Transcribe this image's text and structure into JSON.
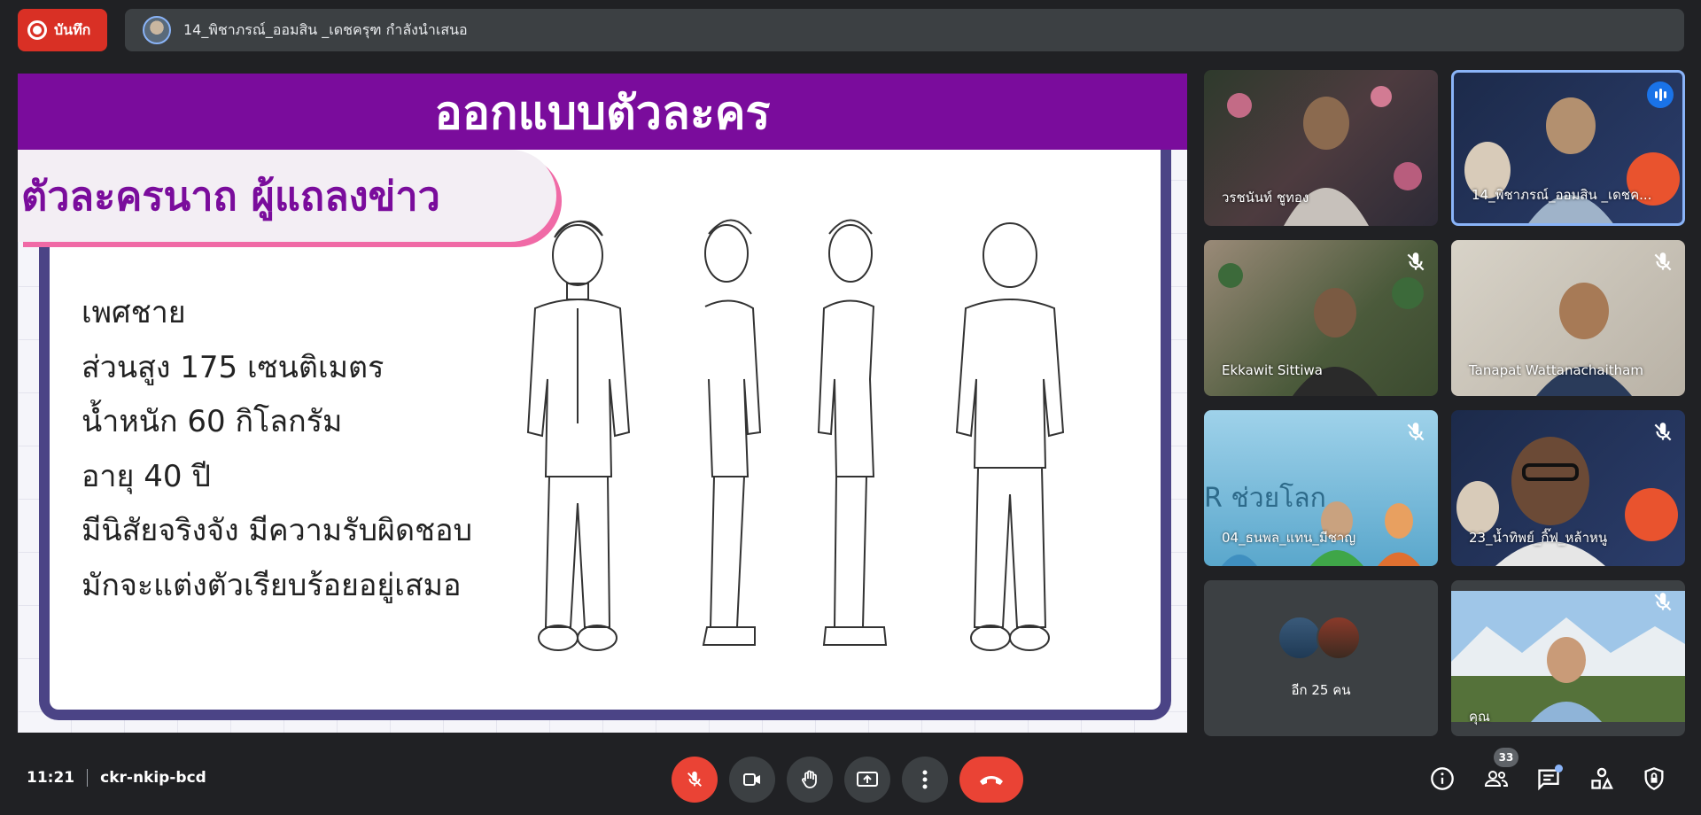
{
  "top_bar": {
    "record_label": "บันทึก",
    "presenter_text": "14_พิชาภรณ์_ออมสิน _เดชครุฑ กำลังนำเสนอ"
  },
  "slide": {
    "header": "ออกแบบตัวละคร",
    "character_title": "ตัวละครนาถ ผู้แถลงข่าว",
    "details": [
      "เพศชาย",
      "ส่วนสูง 175 เซนติเมตร",
      "น้ำหนัก 60 กิโลกรัม",
      "อายุ 40 ปี",
      "มีนิสัยจริงจัง มีความรับผิดชอบ",
      "มักจะแต่งตัวเรียบร้อยอยู่เสมอ"
    ]
  },
  "participants": [
    {
      "name": "วรชนันท์ ชูทอง",
      "muted": false
    },
    {
      "name": "14_พิชาภรณ์_ออมสิน _เดชค...",
      "speaking": true
    },
    {
      "name": "Ekkawit Sittiwa",
      "muted": true
    },
    {
      "name": "Tanapat Wattanachaitham",
      "muted": true
    },
    {
      "name": "04_ธนพล_แทน_มีชาญ",
      "muted": true,
      "bg_text": "R ช่วยโลก"
    },
    {
      "name": "23_น้ำทิพย์_กิ๊ฟ_หล้าหนู",
      "muted": true
    },
    {
      "name": "อีก 25 คน"
    },
    {
      "name": "คุณ",
      "muted": true
    }
  ],
  "bottom_bar": {
    "time": "11:21",
    "meeting_code": "ckr-nkip-bcd",
    "participant_count": "33"
  },
  "colors": {
    "bg": "#202124",
    "tile": "#3c4043",
    "red": "#ea4335",
    "accent_blue": "#8ab4f8",
    "slide_purple": "#7a0c9c",
    "slide_pink": "#f06aa6"
  }
}
